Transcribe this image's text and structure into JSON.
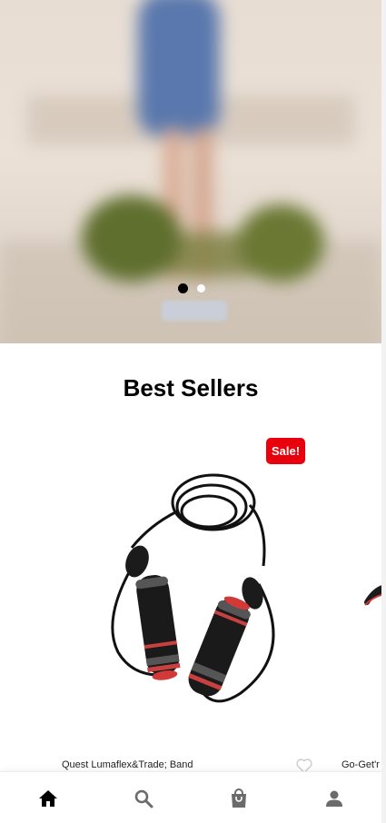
{
  "hero": {
    "carousel": {
      "slide_count": 2,
      "active_index": 0
    }
  },
  "best_sellers": {
    "title": "Best Sellers",
    "products": [
      {
        "name": "Quest Lumaflex&Trade; Band",
        "badge": "Sale!",
        "image_icon": "jump-rope-icon",
        "wishlist_icon": "heart-outline-icon"
      },
      {
        "name": "Go-Get'r",
        "image_icon": "product-image-icon"
      }
    ]
  },
  "bottom_nav": {
    "items": [
      {
        "icon": "home-icon",
        "active": true
      },
      {
        "icon": "search-icon",
        "active": false
      },
      {
        "icon": "shopping-bag-icon",
        "active": false
      },
      {
        "icon": "account-icon",
        "active": false
      }
    ]
  },
  "colors": {
    "sale_badge": "#e8000d",
    "nav_active": "#000000",
    "nav_inactive": "#6b6b6b",
    "dot_active": "#000000",
    "dot_inactive": "#ffffff"
  }
}
